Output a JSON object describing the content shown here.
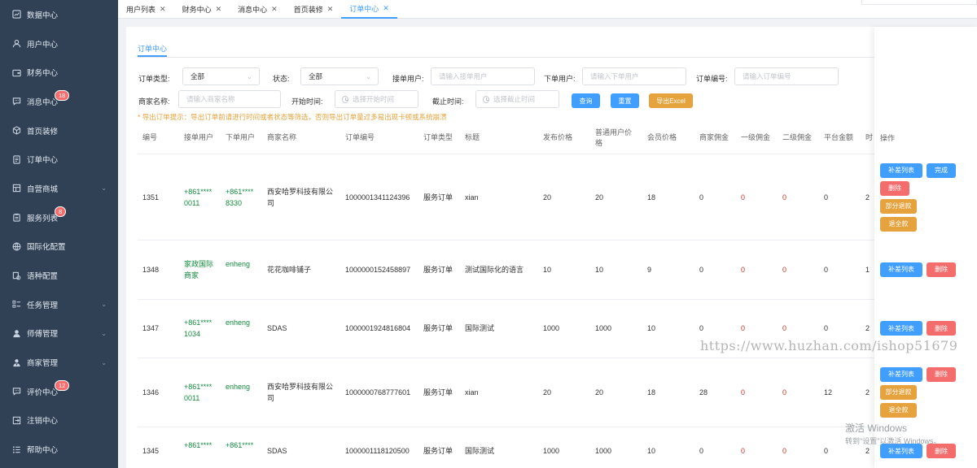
{
  "sidebar": {
    "items": [
      {
        "label": "数据中心",
        "icon": "dashboard-icon",
        "badge": "",
        "chevron": false
      },
      {
        "label": "用户中心",
        "icon": "user-icon",
        "badge": "",
        "chevron": false
      },
      {
        "label": "财务中心",
        "icon": "wallet-icon",
        "badge": "",
        "chevron": false
      },
      {
        "label": "消息中心",
        "icon": "message-icon",
        "badge": "18",
        "chevron": false
      },
      {
        "label": "首页装修",
        "icon": "cube-icon",
        "badge": "",
        "chevron": false
      },
      {
        "label": "订单中心",
        "icon": "order-icon",
        "badge": "",
        "chevron": false
      },
      {
        "label": "自营商城",
        "icon": "shop-icon",
        "badge": "",
        "chevron": true
      },
      {
        "label": "服务列表",
        "icon": "clipboard-icon",
        "badge": "8",
        "chevron": false
      },
      {
        "label": "国际化配置",
        "icon": "globe-icon",
        "badge": "",
        "chevron": false
      },
      {
        "label": "语种配置",
        "icon": "language-icon",
        "badge": "",
        "chevron": false
      },
      {
        "label": "任务管理",
        "icon": "task-icon",
        "badge": "",
        "chevron": true
      },
      {
        "label": "师傅管理",
        "icon": "worker-icon",
        "badge": "",
        "chevron": true
      },
      {
        "label": "商家管理",
        "icon": "merchant-icon",
        "badge": "",
        "chevron": true
      },
      {
        "label": "评价中心",
        "icon": "comment-icon",
        "badge": "12",
        "chevron": false
      },
      {
        "label": "注销中心",
        "icon": "logout-icon",
        "badge": "",
        "chevron": false
      },
      {
        "label": "帮助中心",
        "icon": "help-icon",
        "badge": "",
        "chevron": false
      }
    ]
  },
  "tabs": [
    {
      "label": "用户列表",
      "active": false
    },
    {
      "label": "财务中心",
      "active": false
    },
    {
      "label": "消息中心",
      "active": false
    },
    {
      "label": "首页装修",
      "active": false
    },
    {
      "label": "订单中心",
      "active": true
    }
  ],
  "tab_close": "✕",
  "page": {
    "subtab": "订单中心"
  },
  "filters": {
    "order_type_label": "订单类型:",
    "order_type_value": "全部",
    "status_label": "状态:",
    "status_value": "全部",
    "receiver_label": "接单用户:",
    "receiver_placeholder": "请输入接单用户",
    "orderer_label": "下单用户:",
    "orderer_placeholder": "请输入下单用户",
    "order_no_label": "订单编号:",
    "order_no_placeholder": "请输入订单编号",
    "merchant_label": "商家名称:",
    "merchant_placeholder": "请输入商家名称",
    "start_label": "开始时间:",
    "start_placeholder": "选择开始时间",
    "end_label": "截止时间:",
    "end_placeholder": "选择截止时间",
    "query_btn": "查询",
    "reset_btn": "重置",
    "export_btn": "导出Excel",
    "hint": "* 导出订单提示：导出订单前请进行时间或者状态等筛选，否则导出订单量过多易出现卡顿或系统崩溃"
  },
  "table": {
    "headers": [
      "编号",
      "接单用户",
      "下单用户",
      "商家名称",
      "订单编号",
      "订单类型",
      "标题",
      "发布价格",
      "普通用户价格",
      "会员价格",
      "商家佣金",
      "一级佣金",
      "二级佣金",
      "平台金额",
      "时"
    ],
    "actions_header": "操作",
    "rows": [
      {
        "id": "1351",
        "receiver": "+861****0011",
        "orderer": "+861****8330",
        "merchant": "西安哈罗科技有限公司",
        "order_no": "1000001341124396",
        "type": "服务订单",
        "title": "xian",
        "publish": "20",
        "normal": "20",
        "member": "18",
        "merchant_comm": "0",
        "level1": "0",
        "level2": "0",
        "platform": "0",
        "time": "2"
      },
      {
        "id": "1348",
        "receiver": "家政国际商家",
        "orderer": "enheng",
        "merchant": "花花咖啡铺子",
        "order_no": "1000000152458897",
        "type": "服务订单",
        "title": "测试国际化的语言",
        "publish": "10",
        "normal": "10",
        "member": "9",
        "merchant_comm": "0",
        "level1": "0",
        "level2": "0",
        "platform": "0",
        "time": "1"
      },
      {
        "id": "1347",
        "receiver": "+861****1034",
        "orderer": "enheng",
        "merchant": "SDAS",
        "order_no": "1000001924816804",
        "type": "服务订单",
        "title": "国际测试",
        "publish": "1000",
        "normal": "1000",
        "member": "10",
        "merchant_comm": "0",
        "level1": "0",
        "level2": "0",
        "platform": "0",
        "time": "2"
      },
      {
        "id": "1346",
        "receiver": "+861****0011",
        "orderer": "enheng",
        "merchant": "西安哈罗科技有限公司",
        "order_no": "1000000768777601",
        "type": "服务订单",
        "title": "xian",
        "publish": "20",
        "normal": "20",
        "member": "18",
        "merchant_comm": "28",
        "level1": "0",
        "level2": "0",
        "platform": "12",
        "time": "2"
      },
      {
        "id": "1345",
        "receiver": "+861****",
        "orderer": "+861****",
        "merchant": "SDAS",
        "order_no": "1000001118120500",
        "type": "服务订单",
        "title": "国际测试",
        "publish": "1000",
        "normal": "1000",
        "member": "10",
        "merchant_comm": "0",
        "level1": "0",
        "level2": "0",
        "platform": "0",
        "time": "2"
      }
    ],
    "actions": {
      "supplement": "补差列表",
      "complete": "完成",
      "delete": "删除",
      "partial_refund": "部分退款",
      "full_refund": "退全款"
    }
  },
  "overlay": {
    "watermark": "https://www.huzhan.com/ishop51679",
    "activate_title": "激活 Windows",
    "activate_sub": "转到\"设置\"以激活 Windows。"
  }
}
